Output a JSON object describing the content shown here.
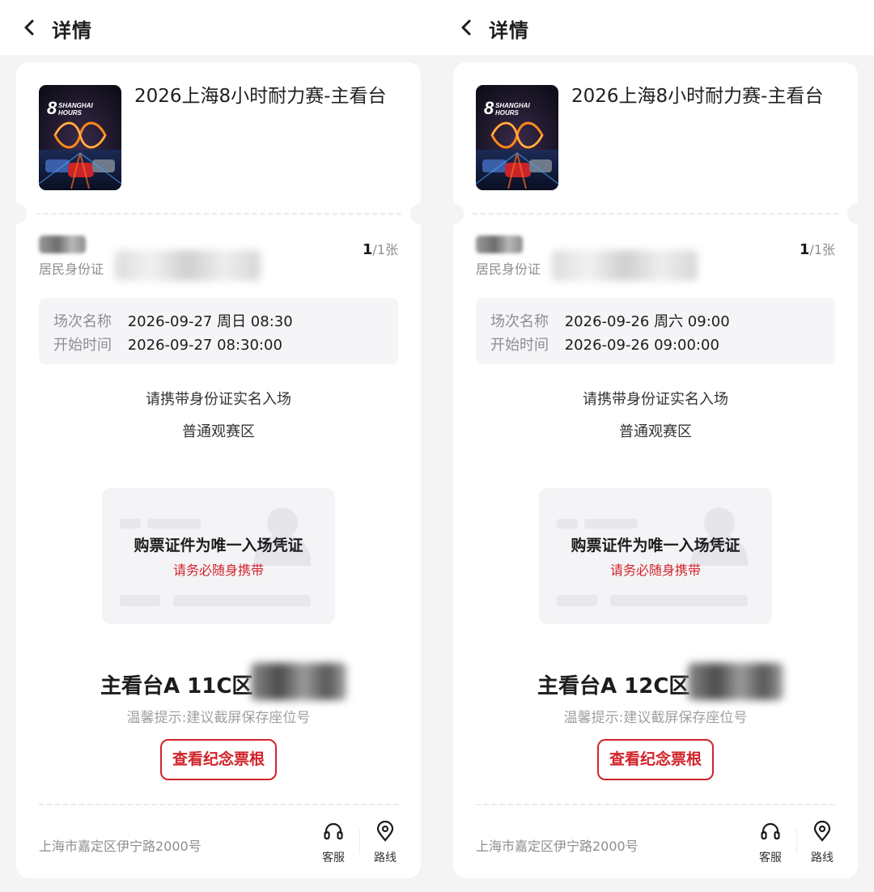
{
  "screens": [
    {
      "header": {
        "title": "详情"
      },
      "event": {
        "name": "2026上海8小时耐力赛-主看台",
        "poster_text": "8 SHANGHAI HOURS"
      },
      "ticket": {
        "id_type": "居民身份证",
        "count_current": "1",
        "count_total": "/1张"
      },
      "session": {
        "name_label": "场次名称",
        "name_value": "2026-09-27 周日 08:30",
        "start_label": "开始时间",
        "start_value": "2026-09-27 08:30:00"
      },
      "notices": [
        "请携带身份证实名入场",
        "普通观赛区"
      ],
      "id_card": {
        "title": "购票证件为唯一入场凭证",
        "subtitle": "请务必随身携带"
      },
      "seat": {
        "area": "主看台A 11C区",
        "tip": "温馨提示:建议截屏保存座位号"
      },
      "stub_button": "查看纪念票根",
      "footer": {
        "address": "上海市嘉定区伊宁路2000号",
        "service_label": "客服",
        "route_label": "路线"
      }
    },
    {
      "header": {
        "title": "详情"
      },
      "event": {
        "name": "2026上海8小时耐力赛-主看台",
        "poster_text": "8 SHANGHAI HOURS"
      },
      "ticket": {
        "id_type": "居民身份证",
        "count_current": "1",
        "count_total": "/1张"
      },
      "session": {
        "name_label": "场次名称",
        "name_value": "2026-09-26 周六 09:00",
        "start_label": "开始时间",
        "start_value": "2026-09-26 09:00:00"
      },
      "notices": [
        "请携带身份证实名入场",
        "普通观赛区"
      ],
      "id_card": {
        "title": "购票证件为唯一入场凭证",
        "subtitle": "请务必随身携带"
      },
      "seat": {
        "area": "主看台A 12C区",
        "tip": "温馨提示:建议截屏保存座位号"
      },
      "stub_button": "查看纪念票根",
      "footer": {
        "address": "上海市嘉定区伊宁路2000号",
        "service_label": "客服",
        "route_label": "路线"
      }
    }
  ],
  "colors": {
    "accent_red": "#d1232a",
    "background": "#f4f4f5",
    "card": "#ffffff"
  },
  "icons": [
    "back-arrow-icon",
    "headset-icon",
    "location-pin-icon"
  ]
}
